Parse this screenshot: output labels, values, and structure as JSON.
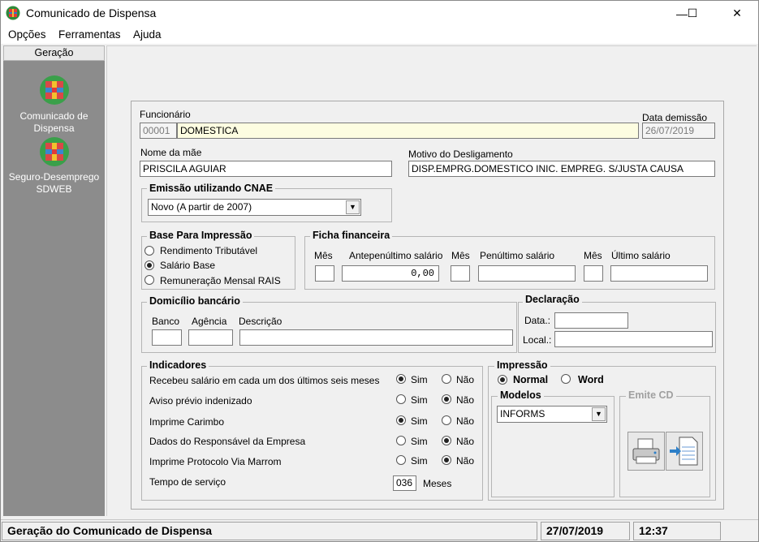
{
  "window": {
    "title": "Comunicado de Dispensa",
    "controls": {
      "minimize": "—",
      "maximize": "☐",
      "close": "✕"
    }
  },
  "menu": [
    "Opções",
    "Ferramentas",
    "Ajuda"
  ],
  "sidebar": {
    "header": "Geração",
    "items": [
      {
        "line1": "Comunicado de",
        "line2": "Dispensa"
      },
      {
        "line1": "Seguro-Desemprego",
        "line2": "SDWEB"
      }
    ]
  },
  "form": {
    "funcionario": {
      "label": "Funcionário",
      "code": "00001",
      "name": "DOMESTICA"
    },
    "data_demissao": {
      "label": "Data demissão",
      "value": "26/07/2019"
    },
    "nome_mae": {
      "label": "Nome da mãe",
      "value": "PRISCILA AGUIAR"
    },
    "motivo": {
      "label": "Motivo do Desligamento",
      "value": "DISP.EMPRG.DOMESTICO INIC. EMPREG. S/JUSTA CAUSA"
    },
    "cnae": {
      "legend": "Emissão utilizando CNAE",
      "selected": "Novo (A partir de 2007)"
    },
    "base_impressao": {
      "legend": "Base Para Impressão",
      "options": [
        "Rendimento Tributável",
        "Salário Base",
        "Remuneração Mensal RAIS"
      ],
      "selected_index": 1
    },
    "ficha": {
      "legend": "Ficha financeira",
      "mes1": "Mês",
      "antepenultimo": "Antepenúltimo salário",
      "antepenultimo_value": "0,00",
      "mes2": "Mês",
      "penultimo": "Penúltimo salário",
      "mes3": "Mês",
      "ultimo": "Último salário"
    },
    "domicilio": {
      "legend": "Domicílio bancário",
      "banco": "Banco",
      "agencia": "Agência",
      "descricao": "Descrição"
    },
    "declaracao": {
      "legend": "Declaração",
      "data": "Data.:",
      "local": "Local.:"
    },
    "indicadores": {
      "legend": "Indicadores",
      "sim": "Sim",
      "nao": "Não",
      "rows": [
        {
          "label": "Recebeu salário em cada um dos últimos seis meses",
          "value": "Sim"
        },
        {
          "label": "Aviso prévio indenizado",
          "value": "Não"
        },
        {
          "label": "Imprime Carimbo",
          "value": "Sim"
        },
        {
          "label": "Dados do Responsável da Empresa",
          "value": "Não"
        },
        {
          "label": "Imprime Protocolo Via Marrom",
          "value": "Não"
        }
      ],
      "tempo": {
        "label": "Tempo de serviço",
        "value": "036",
        "unit": "Meses"
      }
    },
    "impressao": {
      "legend": "Impressão",
      "normal": "Normal",
      "word": "Word",
      "selected": "Normal",
      "modelos": {
        "legend": "Modelos",
        "selected": "INFORMS"
      },
      "emite_cd": "Emite CD"
    }
  },
  "status": {
    "message": "Geração do Comunicado de Dispensa",
    "date": "27/07/2019",
    "time": "12:37"
  },
  "colors": {
    "sidebar": "#8c8c8c",
    "field_highlight": "#fdfde1",
    "window_bg": "#f0f0f0"
  }
}
